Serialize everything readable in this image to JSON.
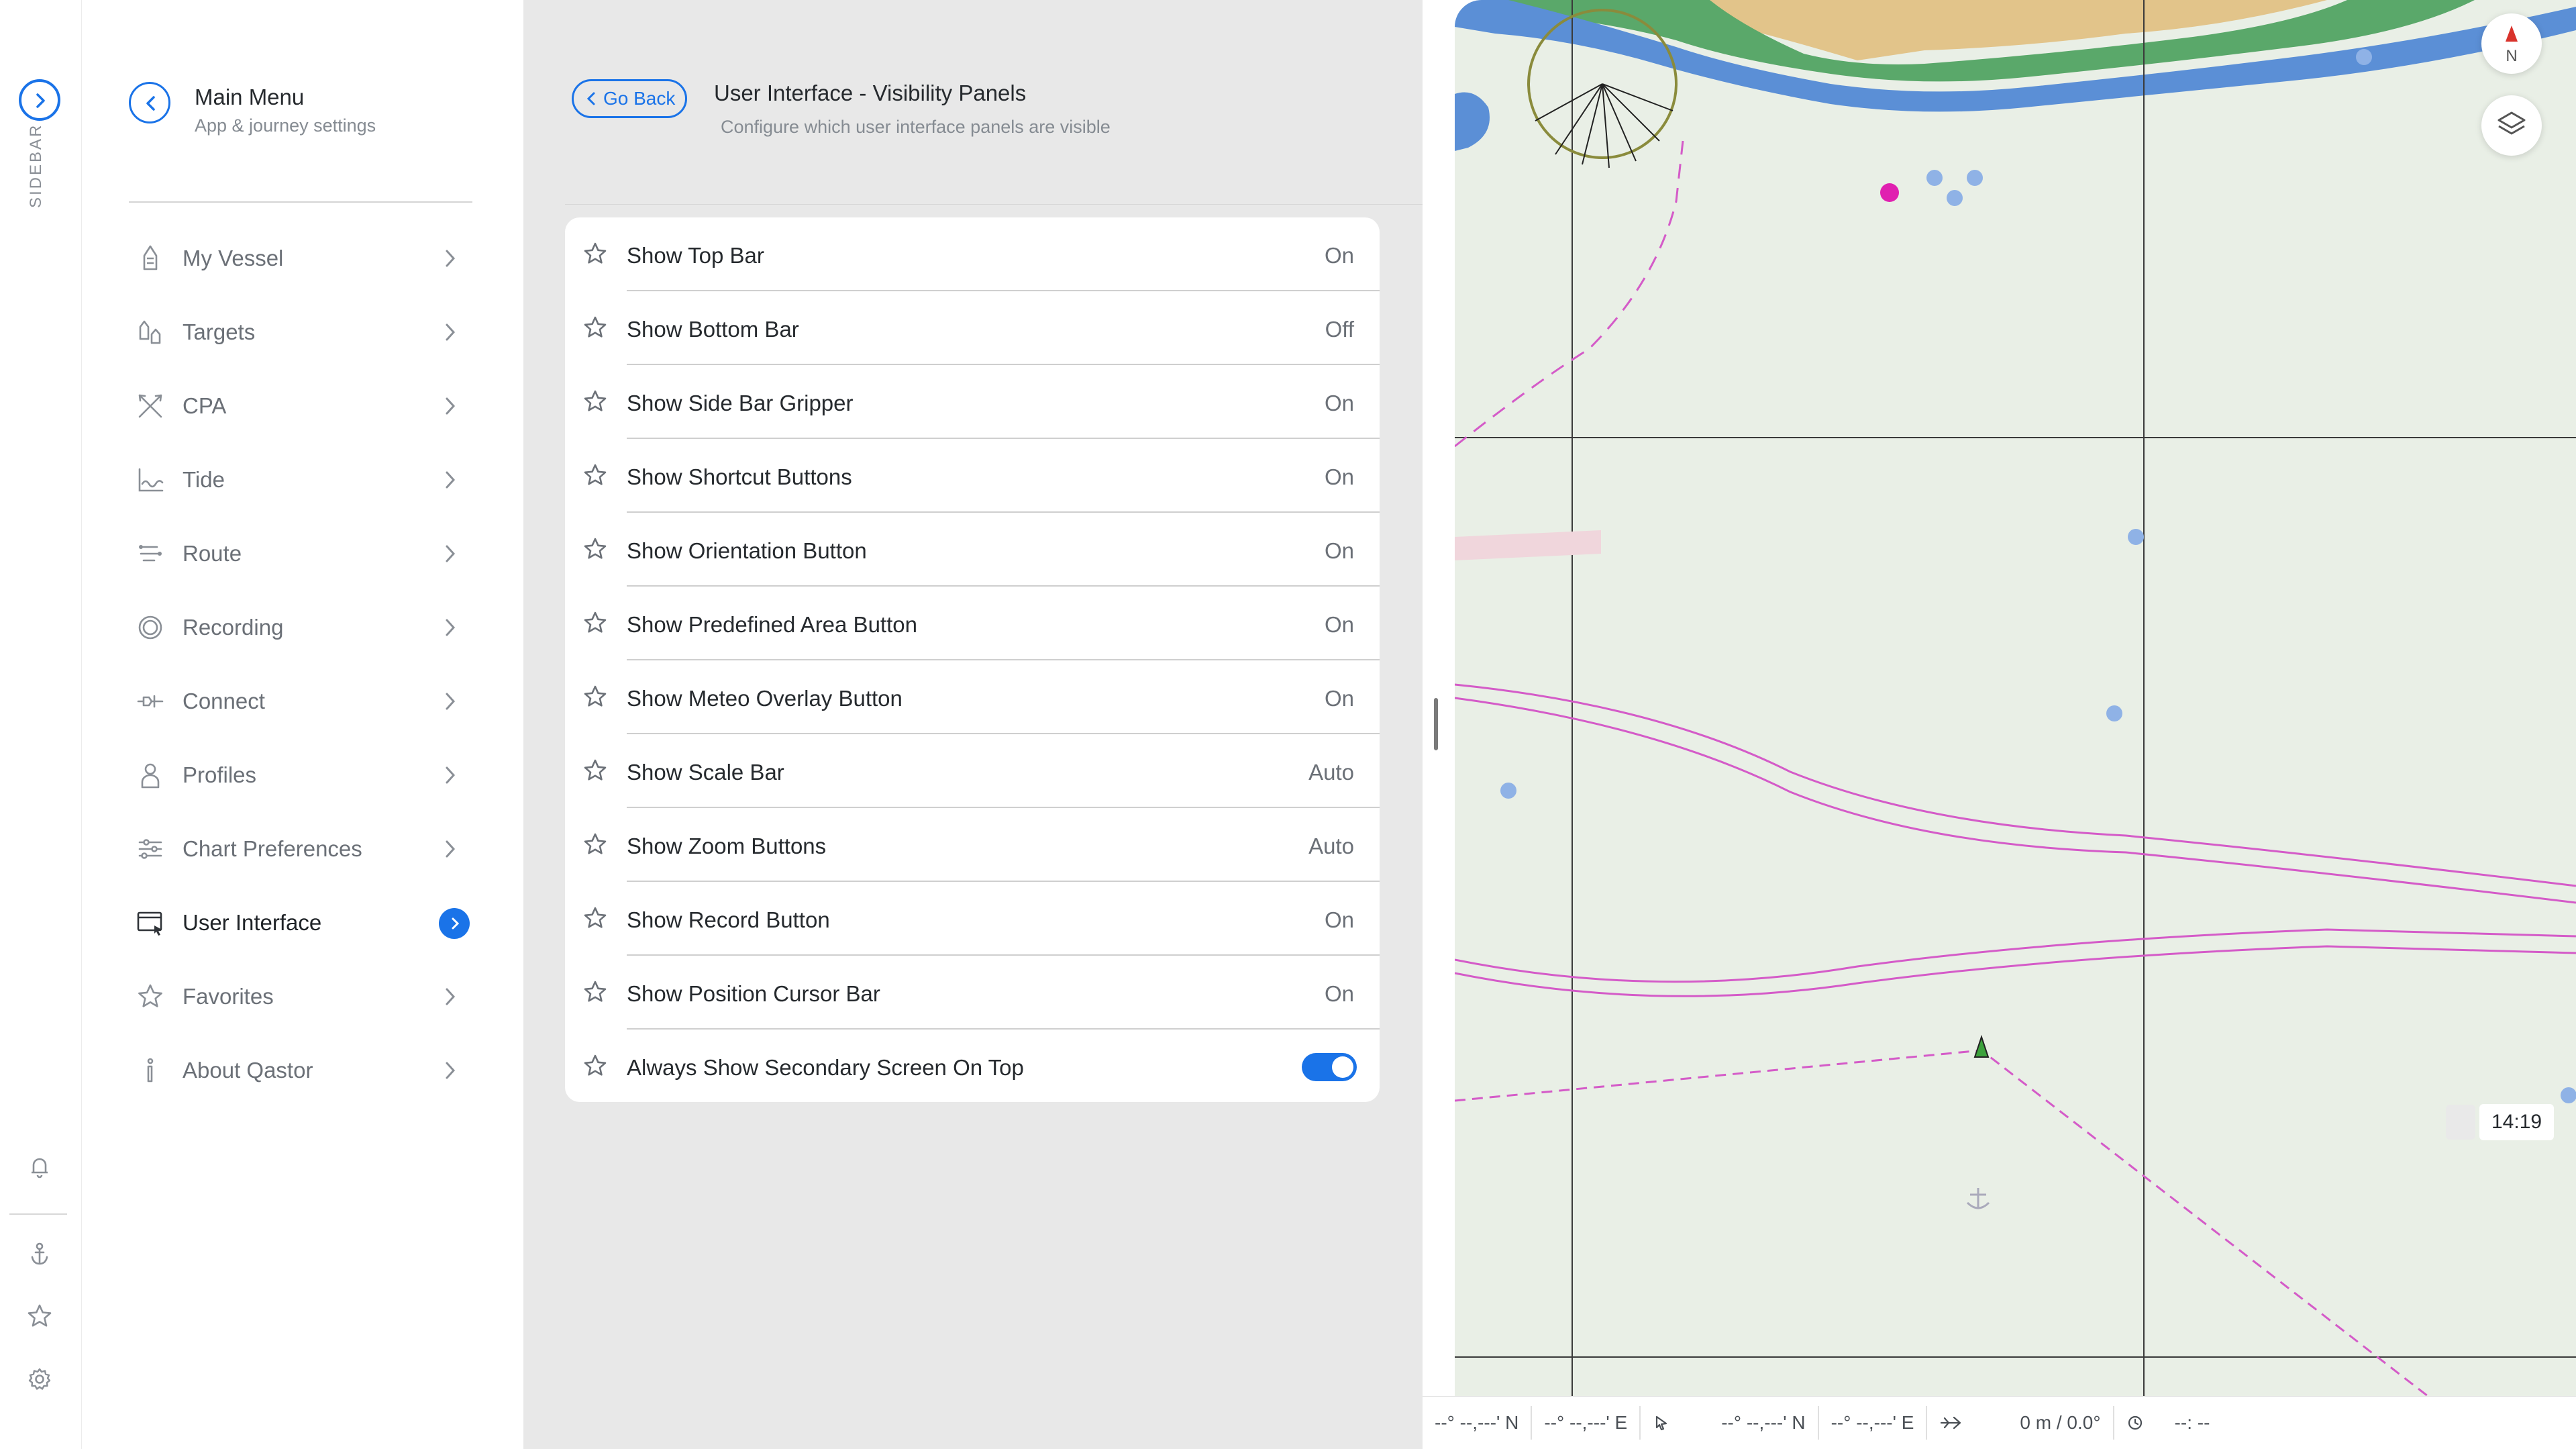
{
  "rail": {
    "label": "SIDEBAR",
    "icons": [
      "chevron-right-icon",
      "bell-icon",
      "anchor-icon",
      "star-icon",
      "gear-icon"
    ]
  },
  "main_menu": {
    "title": "Main Menu",
    "subtitle": "App & journey settings",
    "items": [
      {
        "label": "My Vessel",
        "icon": "vessel-icon"
      },
      {
        "label": "Targets",
        "icon": "targets-icon"
      },
      {
        "label": "CPA",
        "icon": "cpa-icon"
      },
      {
        "label": "Tide",
        "icon": "tide-icon"
      },
      {
        "label": "Route",
        "icon": "route-icon"
      },
      {
        "label": "Recording",
        "icon": "recording-icon"
      },
      {
        "label": "Connect",
        "icon": "connect-icon"
      },
      {
        "label": "Profiles",
        "icon": "profile-icon"
      },
      {
        "label": "Chart Preferences",
        "icon": "sliders-icon"
      },
      {
        "label": "User Interface",
        "icon": "user-interface-icon",
        "active": true
      },
      {
        "label": "Favorites",
        "icon": "star-icon"
      },
      {
        "label": "About Qastor",
        "icon": "info-icon"
      }
    ]
  },
  "panel": {
    "go_back": "Go Back",
    "title": "User Interface - Visibility Panels",
    "subtitle": "Configure which user interface panels are visible",
    "settings": [
      {
        "label": "Show Top Bar",
        "value": "On"
      },
      {
        "label": "Show Bottom Bar",
        "value": "Off"
      },
      {
        "label": "Show Side Bar Gripper",
        "value": "On"
      },
      {
        "label": "Show Shortcut Buttons",
        "value": "On"
      },
      {
        "label": "Show Orientation Button",
        "value": "On"
      },
      {
        "label": "Show Predefined Area Button",
        "value": "On"
      },
      {
        "label": "Show Meteo Overlay Button",
        "value": "On"
      },
      {
        "label": "Show Scale Bar",
        "value": "Auto"
      },
      {
        "label": "Show Zoom Buttons",
        "value": "Auto"
      },
      {
        "label": "Show Record Button",
        "value": "On"
      },
      {
        "label": "Show Position Cursor Bar",
        "value": "On"
      },
      {
        "label": "Always Show Secondary Screen On Top",
        "toggle": true
      }
    ]
  },
  "map": {
    "north": "N",
    "time": "14:19",
    "colors": {
      "land": "#e2c48a",
      "shallow": "#5b8fd6",
      "green": "#5aa86a",
      "sea": "#e9efe6",
      "route": "#d45bc8"
    }
  },
  "status_bar": {
    "vessel_lat": "--° --,---' N",
    "vessel_lon": "--° --,---' E",
    "cursor_lat": "--° --,---' N",
    "cursor_lon": "--° --,---' E",
    "distance_bearing": "0 m / 0.0°",
    "eta": "--: --"
  },
  "accent": "#1a73e8"
}
